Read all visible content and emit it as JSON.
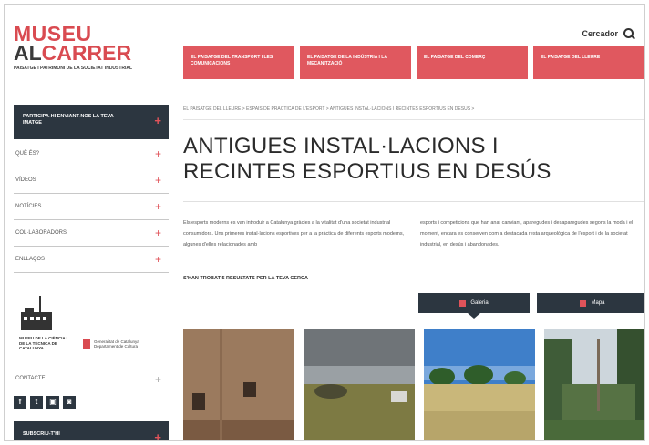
{
  "logo": {
    "line1": "MUSEU",
    "line2_prefix": "AL",
    "line2_suffix": "CARRER",
    "subtitle": "PAISATGE I PATRIMONI DE LA SOCIETAT INDUSTRIAL"
  },
  "sidebar": {
    "cta_top": "PARTICIPA-HI ENVIANT-NOS LA TEVA IMATGE",
    "cta_plus": "+",
    "items": [
      {
        "label": "QUÈ ÉS?"
      },
      {
        "label": "VÍDEOS"
      },
      {
        "label": "NOTÍCIES"
      },
      {
        "label": "COL·LABORADORS"
      },
      {
        "label": "ENLLAÇOS"
      }
    ],
    "partner_text": "MUSEU DE LA CIÈNCIA I DE LA TÈCNICA DE CATALUNYA",
    "gov_text": "Generalitat de Catalunya Departament de Cultura",
    "contact_label": "CONTACTE",
    "social": [
      "f",
      "t",
      "▣",
      "◙"
    ],
    "cta_bottom": "SUBSCRIU-T'HI"
  },
  "header": {
    "search_label": "Cercador",
    "tabs": [
      "EL PAISATGE DEL TRANSPORT I LES COMUNICACIONS",
      "EL PAISATGE DE LA INDÚSTRIA I LA MECANITZACIÓ",
      "EL PAISATGE DEL COMERÇ",
      "EL PAISATGE DEL LLEURE"
    ]
  },
  "main": {
    "breadcrumb": "EL PAISATGE DEL LLEURE > Espais de pràctica de l'esport > Antigues instal·lacions i recintes esportius en desús >",
    "title": "ANTIGUES INSTAL·LACIONS I RECINTES ESPORTIUS EN DESÚS",
    "intro_col1": "Els esports moderns es van introduir a Catalunya gràcies a la vitalitat d'una societat industrial consumidora. Uns primeres instal·lacions esportives per a la pràctica de diferents esports moderns, algunes d'elles relacionades amb",
    "intro_col2": "esports i competicions que han anat canviant, aparegudes i desaparegudes segons la moda i el moment, encara es conserven com a destacada resta arqueològica de l'esport i de la societat industrial, en desús i abandonades.",
    "results_text": "S'HAN TROBAT 5 RESULTATS PER LA TEVA CERCA",
    "view_gallery": "Galeria",
    "view_map": "Mapa"
  }
}
